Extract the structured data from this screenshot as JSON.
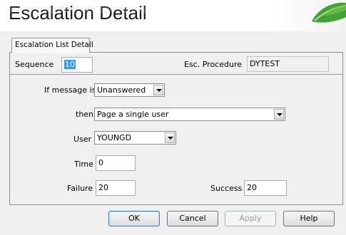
{
  "header": {
    "title": "Escalation Detail"
  },
  "tab": {
    "label": "Escalation List Detail"
  },
  "top": {
    "sequence_label": "Sequence",
    "sequence_value": "10",
    "procedure_label": "Esc. Procedure",
    "procedure_value": "DYTEST"
  },
  "form": {
    "if_message_label": "If message is",
    "if_message_value": "Unanswered",
    "then_label": "then",
    "then_value": "Page a single user",
    "user_label": "User",
    "user_value": "YOUNGD",
    "time_label": "Time",
    "time_value": "0",
    "failure_label": "Failure",
    "failure_value": "20",
    "success_label": "Success",
    "success_value": "20"
  },
  "buttons": {
    "ok": "OK",
    "cancel": "Cancel",
    "apply": "Apply",
    "help": "Help"
  },
  "icons": {
    "header_logo": "green-leaf-icon",
    "dropdown": "chevron-down-icon"
  }
}
